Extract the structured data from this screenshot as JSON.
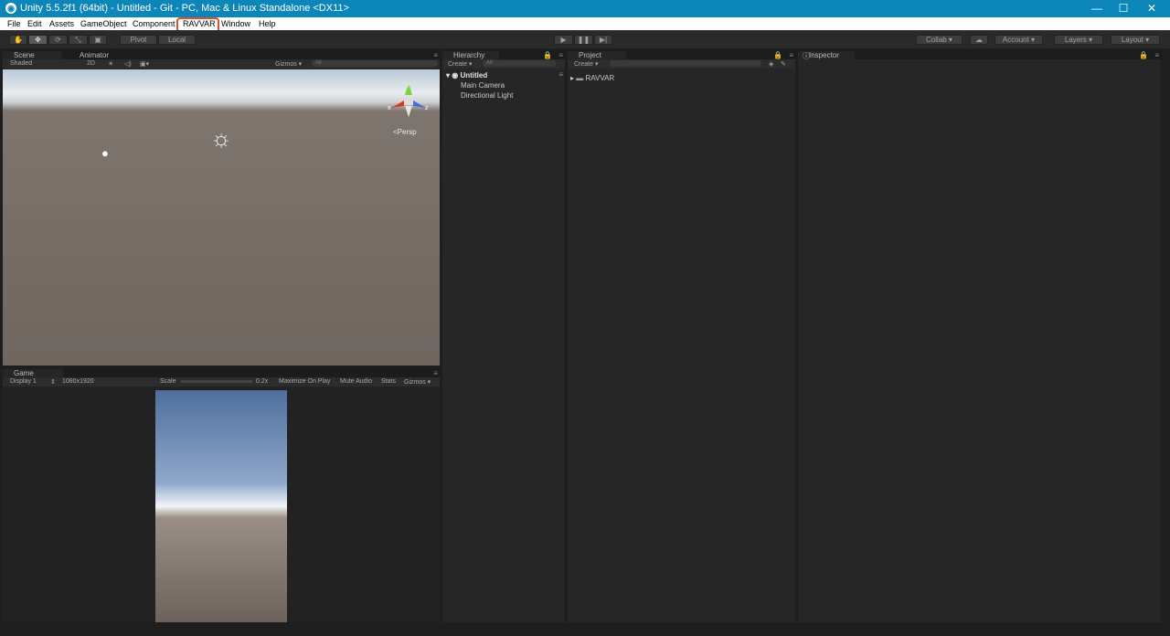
{
  "titlebar": {
    "title": "Unity 5.5.2f1 (64bit) - Untitled - Git - PC, Mac & Linux Standalone <DX11>",
    "minimize": "—",
    "maximize": "☐",
    "close": "✕"
  },
  "menu": [
    "File",
    "Edit",
    "Assets",
    "GameObject",
    "Component",
    "RAVVAR",
    "Window",
    "Help"
  ],
  "toolbar": {
    "pivot": "Pivot",
    "local": "Local",
    "collab": "Collab ▾",
    "account": "Account ▾",
    "layers": "Layers ▾",
    "layout": "Layout ▾"
  },
  "scene": {
    "tab_scene": "Scene",
    "tab_animator": "Animator",
    "shading": "Shaded",
    "mode2d": "2D",
    "gizmos": "Gizmos ▾",
    "search_placeholder": "All",
    "persp": "Persp"
  },
  "game": {
    "tab": "Game",
    "display": "Display 1",
    "resolution": "1080x1920",
    "scale_label": "Scale",
    "scale_value": "0.2x",
    "maximize": "Maximize On Play",
    "mute": "Mute Audio",
    "stats": "Stats",
    "gizmos": "Gizmos ▾"
  },
  "hierarchy": {
    "tab": "Hierarchy",
    "create": "Create ▾",
    "search_placeholder": "All",
    "scene_name": "Untitled",
    "items": [
      "Main Camera",
      "Directional Light"
    ]
  },
  "project": {
    "tab": "Project",
    "create": "Create ▾",
    "folder": "RAVVAR"
  },
  "inspector": {
    "tab": "Inspector"
  }
}
